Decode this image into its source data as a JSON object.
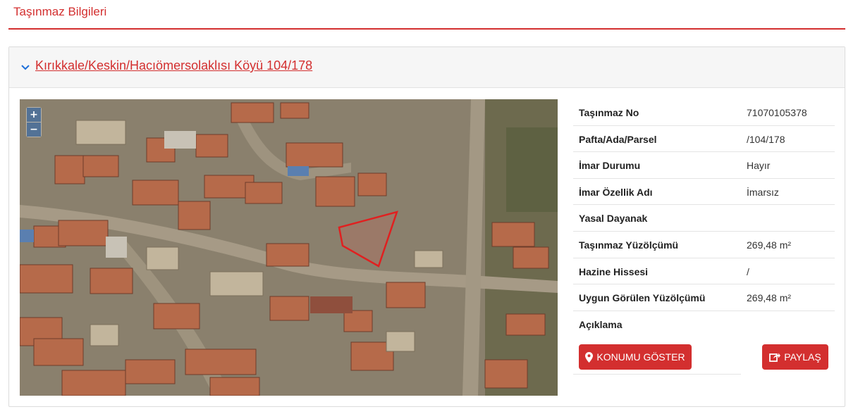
{
  "header": {
    "title": "Taşınmaz Bilgileri"
  },
  "parcel": {
    "link_text": "Kırıkkale/Keskin/Hacıömersolaklısı Köyü 104/178"
  },
  "map": {
    "zoom_in": "+",
    "zoom_out": "−"
  },
  "details": [
    {
      "label": "Taşınmaz No",
      "value": "71070105378"
    },
    {
      "label": "Pafta/Ada/Parsel",
      "value": "/104/178"
    },
    {
      "label": "İmar Durumu",
      "value": "Hayır"
    },
    {
      "label": "İmar Özellik Adı",
      "value": "İmarsız"
    },
    {
      "label": "Yasal Dayanak",
      "value": ""
    },
    {
      "label": "Taşınmaz Yüzölçümü",
      "value": "269,48 m²"
    },
    {
      "label": "Hazine Hissesi",
      "value": "/"
    },
    {
      "label": "Uygun Görülen Yüzölçümü",
      "value": "269,48 m²"
    },
    {
      "label": "Açıklama",
      "value": ""
    }
  ],
  "actions": {
    "show_location": "KONUMU GÖSTER",
    "share": "PAYLAŞ"
  },
  "colors": {
    "accent": "#d32f2f",
    "parcel_outline": "#e02020"
  }
}
